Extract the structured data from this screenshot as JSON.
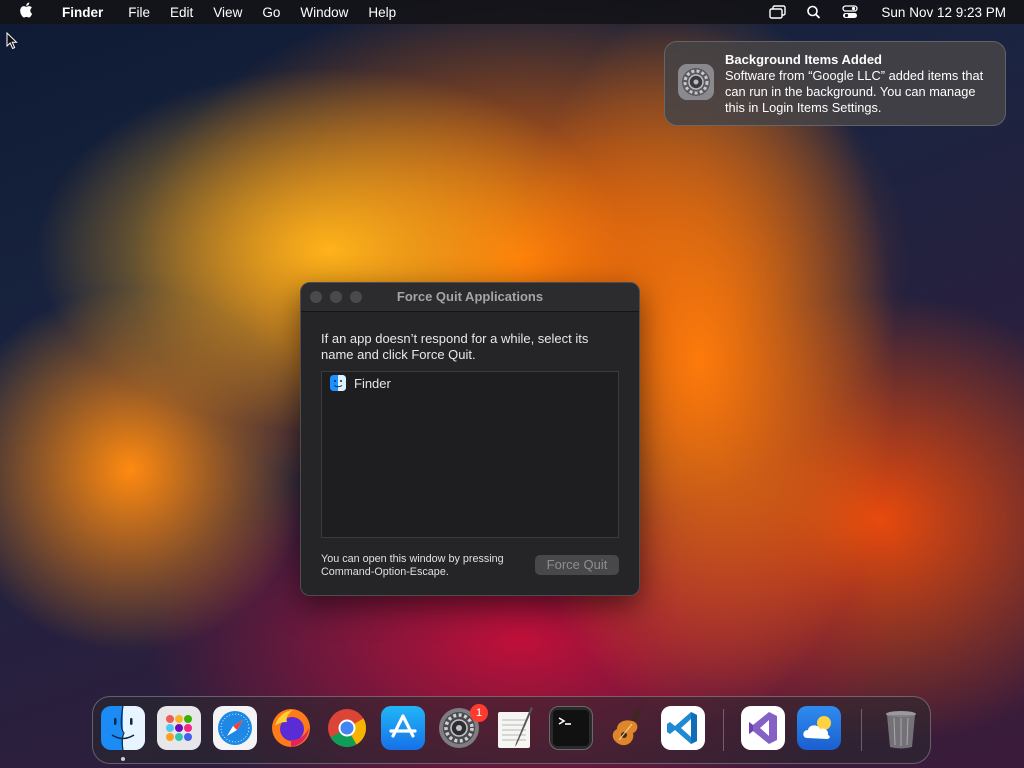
{
  "menubar": {
    "apple_icon": "apple-logo-icon",
    "app_name": "Finder",
    "menus": [
      "File",
      "Edit",
      "View",
      "Go",
      "Window",
      "Help"
    ],
    "status_icons": [
      "screen-mirroring-icon",
      "spotlight-search-icon",
      "control-center-icon"
    ],
    "clock": "Sun Nov 12  9:23 PM"
  },
  "notification": {
    "icon": "system-settings-gear-icon",
    "title": "Background Items Added",
    "body": "Software from “Google LLC” added items that can run in the background. You can manage this in Login Items Settings."
  },
  "force_quit": {
    "title": "Force Quit Applications",
    "prompt": "If an app doesn’t respond for a while, select its name and click Force Quit.",
    "apps": [
      {
        "name": "Finder",
        "icon": "finder-icon"
      }
    ],
    "hint": "You can open this window by pressing Command-Option-Escape.",
    "button": "Force Quit"
  },
  "dock": {
    "apps": [
      {
        "name": "Finder",
        "icon": "finder-icon",
        "running": true
      },
      {
        "name": "Launchpad",
        "icon": "launchpad-icon"
      },
      {
        "name": "Safari",
        "icon": "safari-icon"
      },
      {
        "name": "Firefox",
        "icon": "firefox-icon"
      },
      {
        "name": "Google Chrome",
        "icon": "chrome-icon"
      },
      {
        "name": "App Store",
        "icon": "app-store-icon"
      },
      {
        "name": "System Settings",
        "icon": "system-settings-icon",
        "badge": "1"
      },
      {
        "name": "TextEdit",
        "icon": "textedit-icon"
      },
      {
        "name": "Terminal",
        "icon": "terminal-icon"
      },
      {
        "name": "GarageBand",
        "icon": "garageband-icon"
      },
      {
        "name": "Visual Studio Code",
        "icon": "vscode-icon"
      },
      {
        "name": "Visual Studio",
        "icon": "visual-studio-icon"
      },
      {
        "name": "Weather",
        "icon": "weather-icon"
      },
      {
        "name": "Trash",
        "icon": "trash-icon"
      }
    ]
  },
  "colors": {
    "menubar_bg": "#141418",
    "dialog_bg": "#252527",
    "badge": "#ff3b30"
  }
}
